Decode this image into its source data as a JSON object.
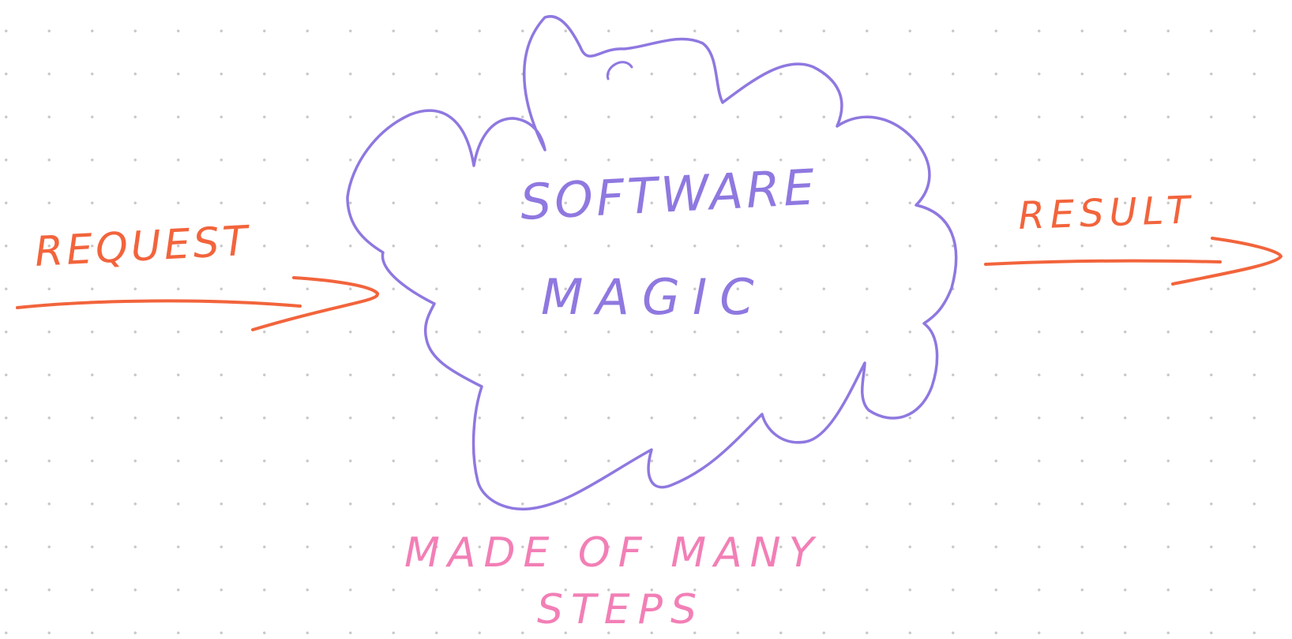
{
  "labels": {
    "request": "REQUEST",
    "result": "RESULT",
    "cloud_line1": "SOFTWARE",
    "cloud_line2": "MAGIC",
    "caption_line1": "MADE OF MANY",
    "caption_line2": "STEPS"
  },
  "colors": {
    "arrow": "#f2643c",
    "cloud": "#8f78e0",
    "caption": "#f27fb6",
    "background": "#ffffff",
    "grid_dot": "#c9c9c9"
  }
}
